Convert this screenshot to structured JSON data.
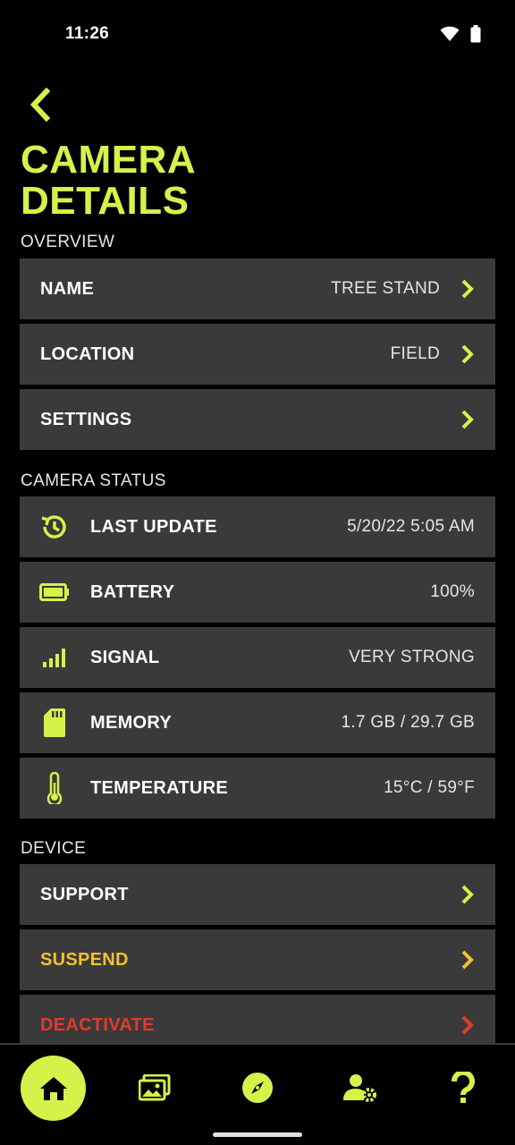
{
  "status_bar": {
    "time": "11:26"
  },
  "header": {
    "title_line1": "CAMERA",
    "title_line2": "DETAILS"
  },
  "overview": {
    "label": "OVERVIEW",
    "items": [
      {
        "label": "NAME",
        "value": "TREE STAND"
      },
      {
        "label": "LOCATION",
        "value": "FIELD"
      },
      {
        "label": "SETTINGS",
        "value": ""
      }
    ]
  },
  "camera_status": {
    "label": "CAMERA STATUS",
    "items": [
      {
        "label": "LAST UPDATE",
        "value": "5/20/22 5:05 AM",
        "icon": "history-icon"
      },
      {
        "label": "BATTERY",
        "value": "100%",
        "icon": "battery-icon"
      },
      {
        "label": "SIGNAL",
        "value": "VERY STRONG",
        "icon": "signal-icon"
      },
      {
        "label": "MEMORY",
        "value": "1.7 GB / 29.7 GB",
        "icon": "sd-card-icon"
      },
      {
        "label": "TEMPERATURE",
        "value": "15°C / 59°F",
        "icon": "thermometer-icon"
      }
    ]
  },
  "device": {
    "label": "DEVICE",
    "items": [
      {
        "label": "SUPPORT"
      },
      {
        "label": "SUSPEND",
        "color": "#f2c132"
      },
      {
        "label": "DEACTIVATE",
        "color": "#e23a2b"
      }
    ]
  },
  "colors": {
    "accent": "#d4f34a",
    "row_bg": "#3a3a3a",
    "suspend": "#f2c132",
    "deactivate": "#e23a2b"
  }
}
